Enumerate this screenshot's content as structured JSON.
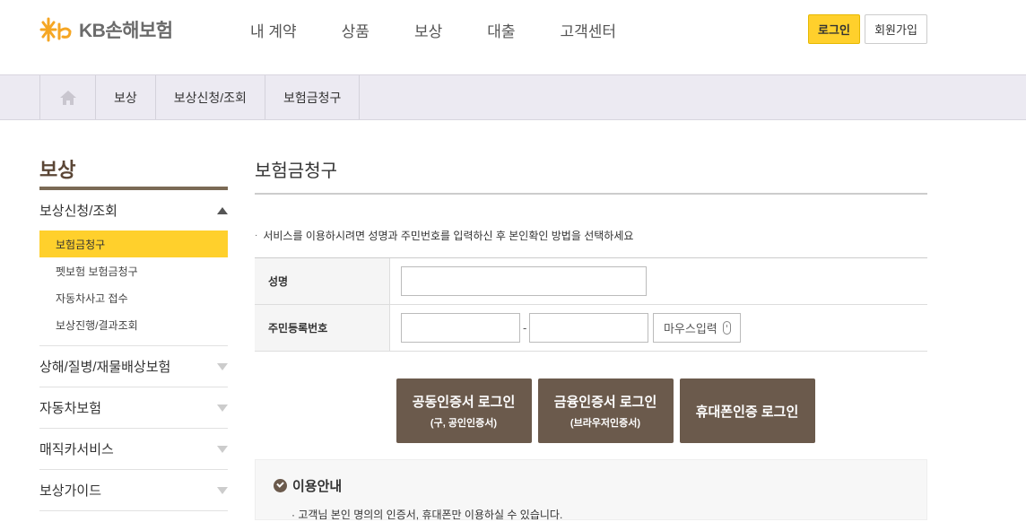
{
  "header": {
    "logo_text": "KB손해보험",
    "nav": [
      "내 계약",
      "상품",
      "보상",
      "대출",
      "고객센터"
    ],
    "login_label": "로그인",
    "join_label": "회원가입"
  },
  "breadcrumb": [
    "보상",
    "보상신청/조회",
    "보험금청구"
  ],
  "lnb": {
    "title": "보상",
    "groups": [
      {
        "label": "보상신청/조회",
        "sub": [
          "보험금청구",
          "펫보험 보험금청구",
          "자동차사고 접수",
          "보상진행/결과조회"
        ]
      },
      {
        "label": "상해/질병/재물배상보험"
      },
      {
        "label": "자동차보험"
      },
      {
        "label": "매직카서비스"
      },
      {
        "label": "보상가이드"
      }
    ]
  },
  "main": {
    "title": "보험금청구",
    "notice": "서비스를 이용하시려면 성명과 주민번호를 입력하신 후 본인확인 방법을 선택하세요",
    "form": {
      "name_label": "성명",
      "name_value": "",
      "jumin_label": "주민등록번호",
      "jumin_front": "",
      "jumin_back": "",
      "dash": "-",
      "mouse_input_label": "마우스입력"
    },
    "auth_buttons": [
      {
        "main": "공동인증서 로그인",
        "sub": "(구, 공인인증서)"
      },
      {
        "main": "금융인증서 로그인",
        "sub": "(브라우저인증서)"
      },
      {
        "main": "휴대폰인증 로그인",
        "sub": ""
      }
    ],
    "guide": {
      "title": "이용안내",
      "text": "· 고객님 본인 명의의 인증서, 휴대폰만 이용하실 수 있습니다."
    }
  },
  "colors": {
    "accent": "#ffd02c",
    "brown": "#6b5a4c",
    "crumb_bg": "#eceaf2"
  }
}
